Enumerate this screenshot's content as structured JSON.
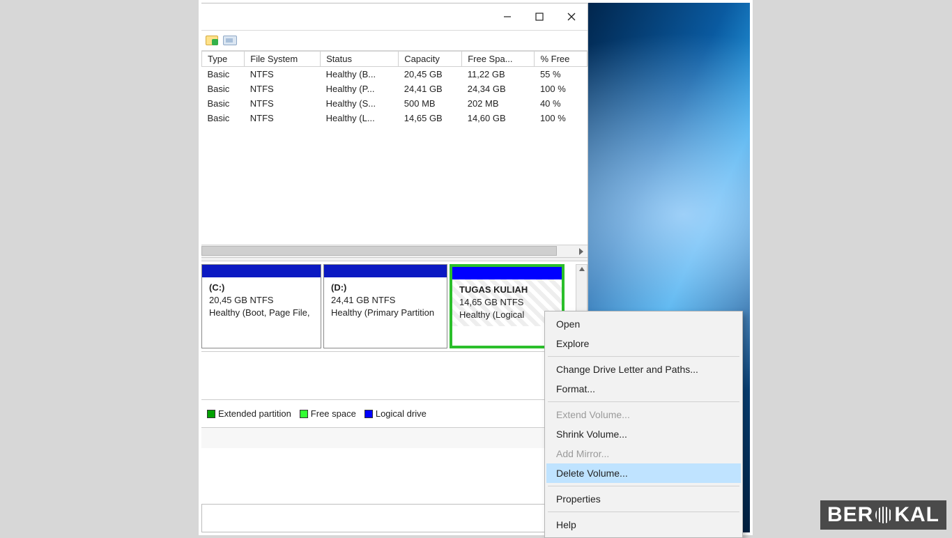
{
  "table": {
    "headers": [
      "Type",
      "File System",
      "Status",
      "Capacity",
      "Free Spa...",
      "% Free"
    ],
    "rows": [
      [
        "Basic",
        "NTFS",
        "Healthy (B...",
        "20,45 GB",
        "11,22 GB",
        "55 %"
      ],
      [
        "Basic",
        "NTFS",
        "Healthy (P...",
        "24,41 GB",
        "24,34 GB",
        "100 %"
      ],
      [
        "Basic",
        "NTFS",
        "Healthy (S...",
        "500 MB",
        "202 MB",
        "40 %"
      ],
      [
        "Basic",
        "NTFS",
        "Healthy (L...",
        "14,65 GB",
        "14,60 GB",
        "100 %"
      ]
    ]
  },
  "partitions": {
    "c": {
      "label": "(C:)",
      "size": "20,45 GB NTFS",
      "status": "Healthy (Boot, Page File,"
    },
    "d": {
      "label": "(D:)",
      "size": "24,41 GB NTFS",
      "status": "Healthy (Primary Partition"
    },
    "sel": {
      "label": "TUGAS KULIAH",
      "size": "14,65 GB NTFS",
      "status": "Healthy (Logical"
    }
  },
  "legend": {
    "extended": "Extended partition",
    "free": "Free space",
    "logical": "Logical drive"
  },
  "menu": {
    "open": "Open",
    "explore": "Explore",
    "change": "Change Drive Letter and Paths...",
    "format": "Format...",
    "extend": "Extend Volume...",
    "shrink": "Shrink Volume...",
    "mirror": "Add Mirror...",
    "delete": "Delete Volume...",
    "properties": "Properties",
    "help": "Help"
  },
  "watermark": {
    "pre": "BER",
    "post": "KAL"
  }
}
